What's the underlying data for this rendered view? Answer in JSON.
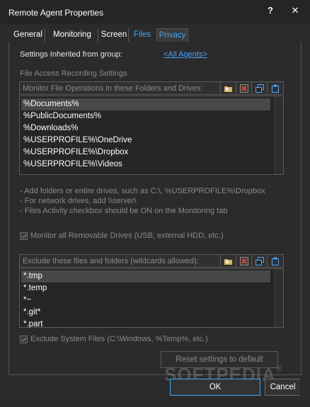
{
  "window": {
    "title": "Remote Agent Properties",
    "help_glyph": "?",
    "close_glyph": "✕"
  },
  "tabs": [
    {
      "label": "General"
    },
    {
      "label": "Monitoring"
    },
    {
      "label": "Screen"
    },
    {
      "label": "Files"
    },
    {
      "label": "Privacy"
    }
  ],
  "inherited": {
    "label": "Settings Inherited from group:",
    "value": "<All Agents>"
  },
  "file_access": {
    "section_label": "File Access Recording Settings",
    "monitor_header": "Monitor File Operations in these Folders and Drives:",
    "folders": [
      "%Documents%",
      "%PublicDocuments%",
      "%Downloads%",
      "%USERPROFILE%\\OneDrive",
      "%USERPROFILE%\\Dropbox",
      "%USERPROFILE%\\Videos"
    ],
    "hints": [
      "- Add folders or entire drives, such as C:\\, %USERPROFILE%\\Dropbox",
      "- For network drives, add \\\\server\\",
      "- Files Activity checkbox should be ON on the Monitoring tab"
    ],
    "removable_label": "Monitor all Removable Drives (USB, external HDD, etc.)",
    "exclude_header": "Exclude these files and folders (wildcards allowed):",
    "excludes": [
      "*.tmp",
      "*.temp",
      "*~",
      "*.git*",
      "*.part"
    ],
    "system_files_label": "Exclude System Files (C:\\Windows, %Temp%, etc.)",
    "reset_label": "Reset settings to default"
  },
  "footer": {
    "ok_label": "OK",
    "cancel_label": "Cancel",
    "watermark": "SOFTPEDIA",
    "watermark_mark": "®"
  },
  "colors": {
    "accent": "#3fa9f5",
    "link": "#4aa3ff",
    "background": "#2b2b2b"
  }
}
